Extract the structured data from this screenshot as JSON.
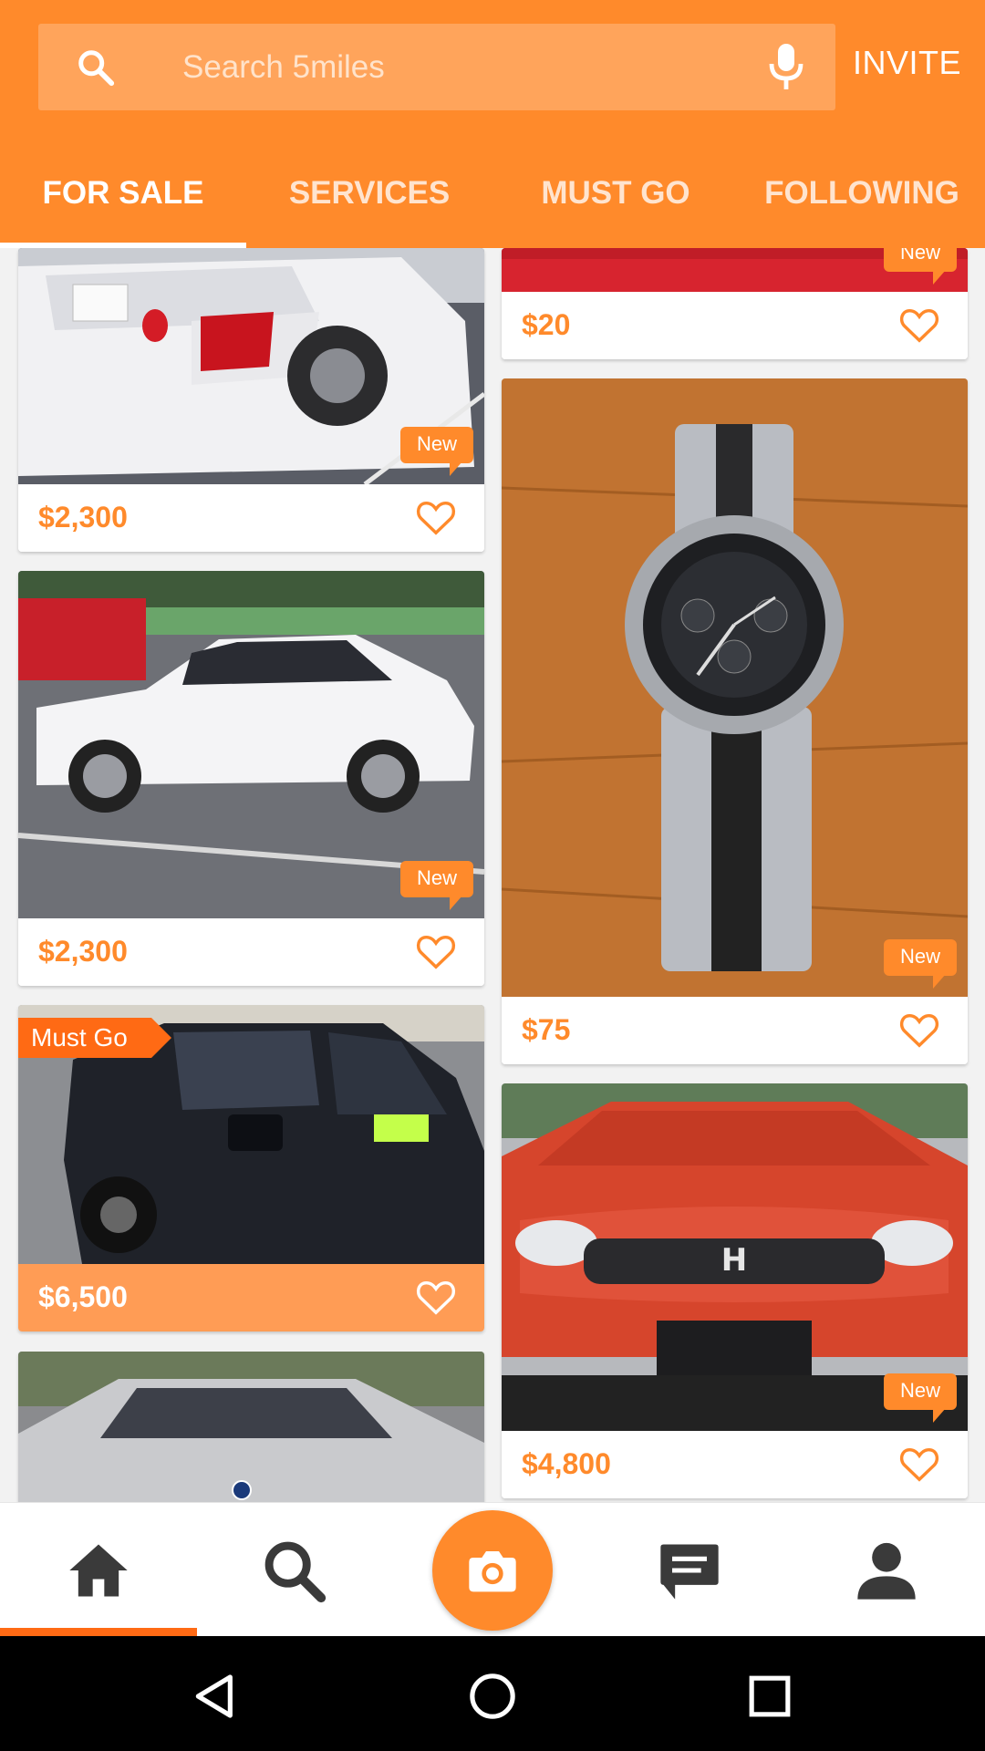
{
  "header": {
    "search_placeholder": "Search 5miles",
    "invite_label": "INVITE",
    "tabs": [
      {
        "label": "FOR SALE",
        "active": true
      },
      {
        "label": "SERVICES",
        "active": false
      },
      {
        "label": "MUST GO",
        "active": false
      },
      {
        "label": "FOLLOWING",
        "active": false
      }
    ]
  },
  "colors": {
    "brand": "#ff8a2b",
    "must_go": "#ff6a14"
  },
  "listings": [
    {
      "price": "$2,300",
      "badge": "New",
      "image": "white-lexus-rear-photo",
      "favorite_icon": "heart-outline-icon"
    },
    {
      "price": "$20",
      "badge": "New",
      "image": "red-item-photo",
      "favorite_icon": "heart-outline-icon"
    },
    {
      "price": "$2,300",
      "badge": "New",
      "image": "white-lexus-side-photo",
      "favorite_icon": "heart-outline-icon"
    },
    {
      "price": "$75",
      "badge": "New",
      "image": "michael-kors-watch-photo",
      "favorite_icon": "heart-outline-icon"
    },
    {
      "price": "$6,500",
      "badge": "Must Go",
      "image": "black-suv-photo",
      "favorite_icon": "heart-outline-icon"
    },
    {
      "price": "$4,800",
      "badge": "New",
      "image": "red-honda-civic-photo",
      "favorite_icon": "heart-outline-icon"
    },
    {
      "price": "",
      "badge": "",
      "image": "silver-bmw-photo",
      "favorite_icon": "heart-outline-icon"
    }
  ],
  "bottom_nav": {
    "items": [
      "home-icon",
      "search-icon",
      "camera-icon",
      "messages-icon",
      "profile-icon"
    ],
    "active": "home-icon"
  },
  "system_nav": [
    "back-icon",
    "home-circle-icon",
    "recents-icon"
  ]
}
